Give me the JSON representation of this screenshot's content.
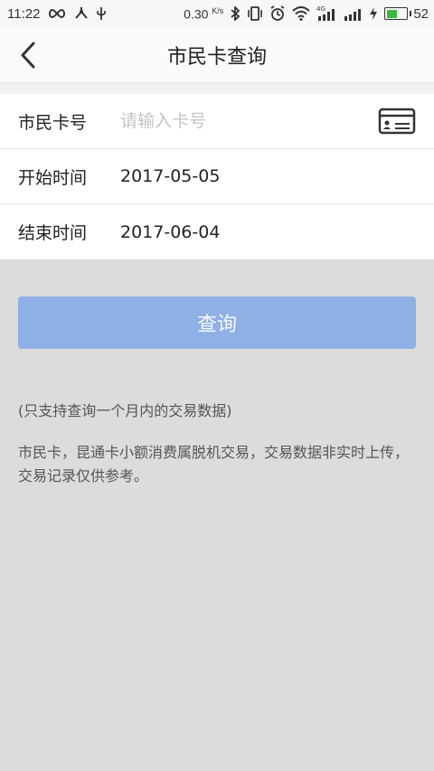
{
  "status_bar": {
    "time": "11:22",
    "speed": "0.30",
    "speed_unit": "K/s",
    "battery": "52",
    "network_label": "4G"
  },
  "header": {
    "title": "市民卡查询"
  },
  "form": {
    "card_label": "市民卡号",
    "card_placeholder": "请输入卡号",
    "start_label": "开始时间",
    "start_value": "2017-05-05",
    "end_label": "结束时间",
    "end_value": "2017-06-04"
  },
  "query_button": "查询",
  "notes": {
    "range": "(只支持查询一个月内的交易数据)",
    "info": "市民卡，昆通卡小额消费属脱机交易，交易数据非实时上传，交易记录仅供参考。"
  },
  "colors": {
    "button_bg": "#8fb0e5",
    "battery_fill": "#3cb83c",
    "page_bg": "#dcdcdc"
  }
}
